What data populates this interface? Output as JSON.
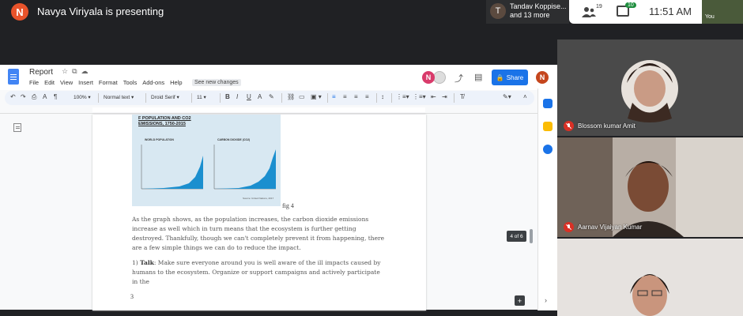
{
  "meet": {
    "presenter_initial": "N",
    "presenting_text": "Navya Viriyala is presenting",
    "participants_chip": {
      "initial": "T",
      "line1": "Tandav Koppise...",
      "line2": "and 13 more"
    },
    "people_count": "19",
    "chat_count": "10",
    "time": "11:51 AM",
    "self_label": "You"
  },
  "doc": {
    "title": "Report",
    "menu": [
      "File",
      "Edit",
      "View",
      "Insert",
      "Format",
      "Tools",
      "Add-ons",
      "Help"
    ],
    "see_changes": "See new changes",
    "collaborator_initial": "N",
    "share_label": "Share",
    "user_initial": "N",
    "toolbar": {
      "zoom": "100%",
      "style": "Normal text",
      "font": "Droid Serif",
      "size": "11"
    },
    "figure": {
      "title_line1": "F POPULATION AND CO2",
      "title_line2": "EMISSIONS, 1750-2015",
      "left_label": "WORLD POPULATION",
      "right_label": "CARBON DIOXIDE (CO2)",
      "source": "Source: United Nations, 2017"
    },
    "caption": "fig 4",
    "paragraph1": "As the graph shows, as the population increases, the carbon dioxide emissions increase as well which in turn means that the ecosystem is further getting destroyed. Thankfully, though we can't completely prevent it from happening, there are a few simple things we can do to reduce the impact.",
    "item1_num": "1) ",
    "item1_bold": "Talk",
    "item1_text": ": Make sure everyone around you is well aware of the ill impacts caused by humans to the ecosystem. Organize or support campaigns and actively participate in the",
    "page_number": "3",
    "page_indicator": "4 of 6"
  },
  "tiles": [
    {
      "name": "Blossom kumar Amit"
    },
    {
      "name": "Aarnav Vijaiyan Kumar"
    }
  ],
  "colors": {
    "share_blue": "#1a73e8",
    "mute_red": "#d93025",
    "chart_blue": "#1b8fcf"
  },
  "icons": [
    "people-icon",
    "chat-icon",
    "star-icon",
    "move-icon",
    "cloud-icon",
    "undo-icon",
    "redo-icon",
    "print-icon",
    "spellcheck-icon",
    "paint-format-icon",
    "bold-icon",
    "italic-icon",
    "underline-icon",
    "text-color-icon",
    "highlight-icon",
    "link-icon",
    "comment-icon",
    "image-icon",
    "align-left-icon",
    "align-center-icon",
    "align-right-icon",
    "justify-icon",
    "line-spacing-icon",
    "numbered-list-icon",
    "bulleted-list-icon",
    "indent-icon",
    "clear-format-icon",
    "edit-mode-icon",
    "mic-off-icon"
  ]
}
